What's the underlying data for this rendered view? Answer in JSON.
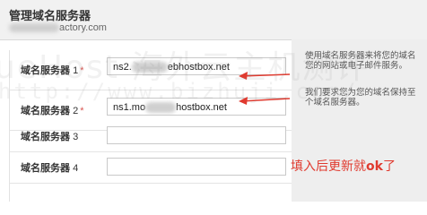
{
  "header": {
    "title": "管理域名服务器",
    "subtitle_suffix": "actory.com"
  },
  "form": {
    "rows": [
      {
        "label": "域名服务器",
        "num": "1",
        "required": "*",
        "value_prefix": "ns2.",
        "value_suffix": "ebhostbox.net"
      },
      {
        "label": "域名服务器",
        "num": "2",
        "required": "*",
        "value_prefix": "ns1.mo",
        "value_suffix": "hostbox.net"
      },
      {
        "label": "域名服务器",
        "num": "3",
        "value": ""
      },
      {
        "label": "域名服务器",
        "num": "4",
        "value": ""
      }
    ]
  },
  "help": {
    "text1_line1": "使用域名服务器来将您的域名",
    "text1_line2": "您的网站或电子邮件服务。",
    "text2_line1": "我们要求您为您的域名保持至",
    "text2_line2": "个域名服务器。"
  },
  "annotation": {
    "text": "填入后更新就",
    "ok": "ok",
    "suffix": "了",
    "color": "#e03a2f"
  },
  "watermark": {
    "line1": "ueHost 海外云主机测评",
    "line2": "http://www.bizhuji.com/"
  },
  "colors": {
    "header_bg": "#f1f1f1",
    "help_bg": "#eeeeee",
    "arrow": "#e03a2f",
    "required": "#d9534f"
  }
}
